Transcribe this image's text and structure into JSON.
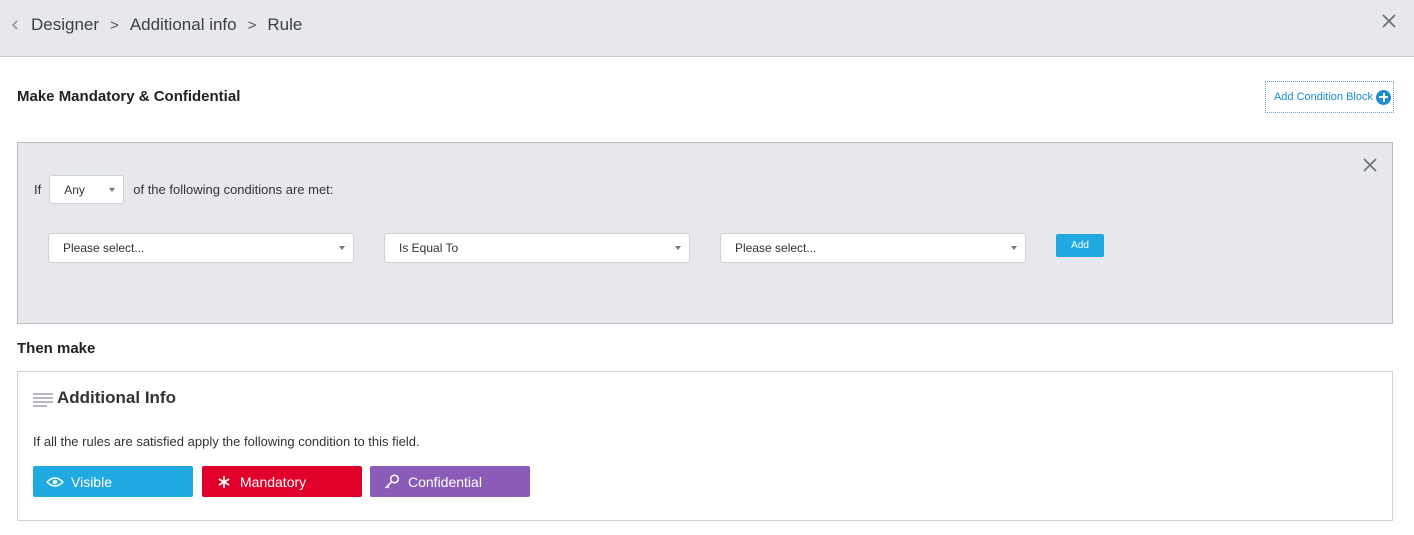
{
  "header": {
    "breadcrumb": [
      "Designer",
      "Additional info",
      "Rule"
    ],
    "separator": ">"
  },
  "rule_title": "Make Mandatory & Confidential",
  "add_condition_block_label": "Add Condition Block",
  "condition_block": {
    "if_label": "If",
    "match_select": "Any",
    "suffix": "of the following conditions are met:",
    "field_select": "Please select...",
    "operator_select": "Is Equal To",
    "value_select": "Please select...",
    "add_button": "Add"
  },
  "then_title": "Then make",
  "result": {
    "field_name": "Additional Info",
    "description": "If all the rules are satisfied apply the following condition to this field.",
    "chips": [
      {
        "label": "Visible",
        "icon": "eye-icon",
        "color": "#21a9e1"
      },
      {
        "label": "Mandatory",
        "icon": "asterisk-icon",
        "color": "#e1002a"
      },
      {
        "label": "Confidential",
        "icon": "key-icon",
        "color": "#8a5cb8"
      }
    ]
  }
}
